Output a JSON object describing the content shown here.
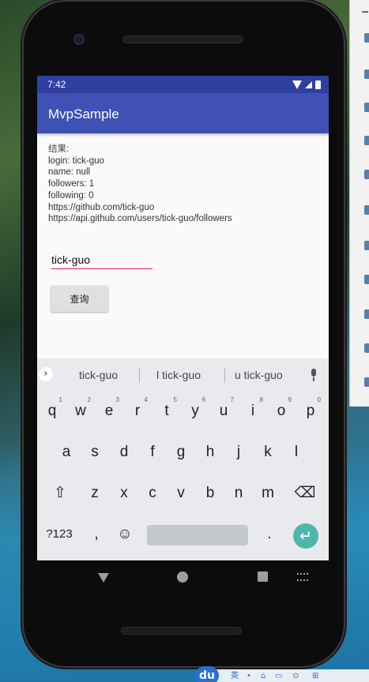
{
  "status_bar": {
    "time": "7:42"
  },
  "app_bar": {
    "title": "MvpSample"
  },
  "result": {
    "title": "结果:",
    "lines": [
      "login: tick-guo",
      "name: null",
      "followers: 1",
      "following: 0",
      "https://github.com/tick-guo",
      "https://api.github.com/users/tick-guo/followers"
    ]
  },
  "input": {
    "value": "tick-guo"
  },
  "query_button": {
    "label": "查询"
  },
  "keyboard": {
    "suggestions": [
      "tick-guo",
      "l tick-guo",
      "u tick-guo"
    ],
    "row1": [
      {
        "key": "q",
        "hint": "1"
      },
      {
        "key": "w",
        "hint": "2"
      },
      {
        "key": "e",
        "hint": "3"
      },
      {
        "key": "r",
        "hint": "4"
      },
      {
        "key": "t",
        "hint": "5"
      },
      {
        "key": "y",
        "hint": "6"
      },
      {
        "key": "u",
        "hint": "7"
      },
      {
        "key": "i",
        "hint": "8"
      },
      {
        "key": "o",
        "hint": "9"
      },
      {
        "key": "p",
        "hint": "0"
      }
    ],
    "row2": [
      "a",
      "s",
      "d",
      "f",
      "g",
      "h",
      "j",
      "k",
      "l"
    ],
    "row3": [
      "z",
      "x",
      "c",
      "v",
      "b",
      "n",
      "m"
    ],
    "symbols_label": "?123",
    "comma": ",",
    "period": ".",
    "emoji_glyph": "☺",
    "shift_glyph": "⇧",
    "backspace_glyph": "⌫",
    "enter_glyph": "↵",
    "more_glyph": "›"
  },
  "taskbar": {
    "app_label": "du",
    "tray_glyphs": [
      "英",
      "•",
      "⌂",
      "▭",
      "⊙",
      "⊞"
    ]
  }
}
